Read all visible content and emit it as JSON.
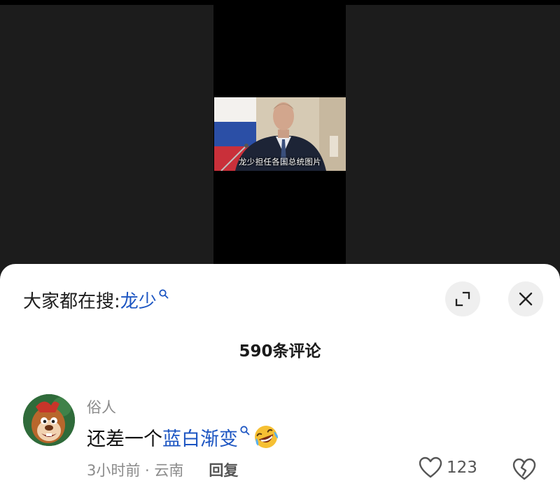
{
  "video": {
    "caption": "龙少担任各国总统图片"
  },
  "sheet": {
    "search_prefix": "大家都在搜:",
    "search_term": "龙少",
    "expand_icon": "expand-icon",
    "close_icon": "close-icon",
    "comment_count": "590条评论"
  },
  "comment": {
    "author": "俗人",
    "text_before": "还差一个",
    "text_link": "蓝白渐变",
    "emoji": "rolling-on-floor-laughing-emoji",
    "time_location": "3小时前 · 云南",
    "reply_label": "回复",
    "like_count": "123"
  },
  "colors": {
    "link": "#1c55c2",
    "muted": "#8b8b8b",
    "sheet_bg": "#ffffff",
    "video_bg": "#000000"
  }
}
